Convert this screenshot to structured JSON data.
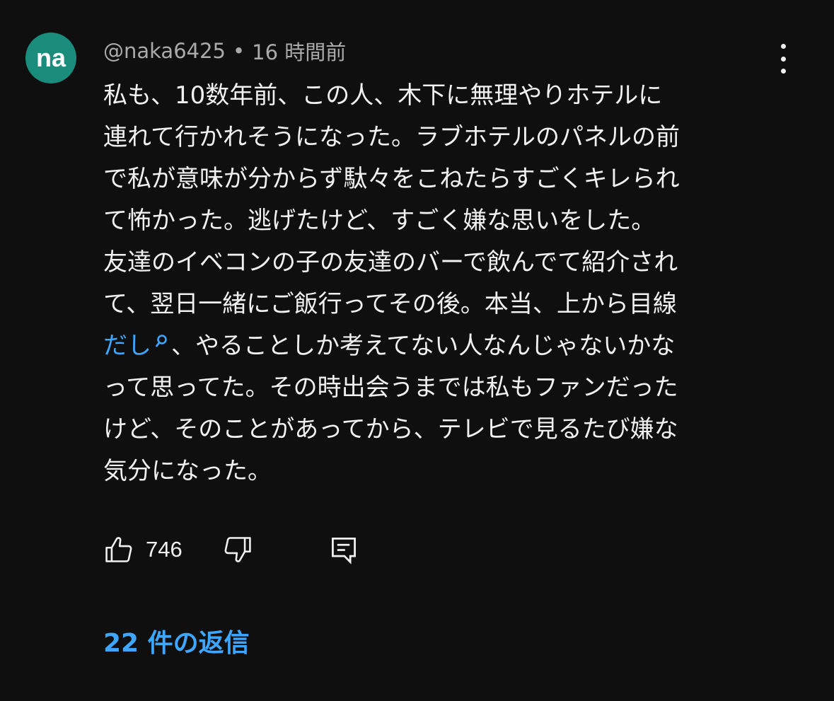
{
  "comment": {
    "avatar_text": "na",
    "avatar_color": "#1a8c7c",
    "author": "@naka6425",
    "separator": "•",
    "time": "16 時間前",
    "more_icon": "kebab-vertical-icon",
    "lines": [
      "私も、10数年前、この人、木下に無理やりホテルに",
      "連れて行かれそうになった。ラブホテルのパネルの前",
      "で私が意味が分からず駄々をこねたらすごくキレられ",
      "て怖かった。逃げたけど、すごく嫌な思いをした。",
      "友達のイベコンの子の友達のバーで飲んでて紹介され",
      "て、翌日一緒にご飯行ってその後。本当、上から目線"
    ],
    "link_text": "だし",
    "link_color": "#3ea6ff",
    "link_icon": "search-icon",
    "line_after_link": "、やることしか考えてない人なんじゃないかな",
    "lines_tail": [
      "って思ってた。その時出会うまでは私もファンだった",
      "けど、そのことがあってから、テレビで見るたび嫌な",
      "気分になった。"
    ]
  },
  "actions": {
    "like_icon": "thumbs-up-icon",
    "like_count": "746",
    "dislike_icon": "thumbs-down-icon",
    "reply_icon": "comment-reply-icon"
  },
  "replies": {
    "label": "22 件の返信",
    "color": "#3ea6ff"
  }
}
